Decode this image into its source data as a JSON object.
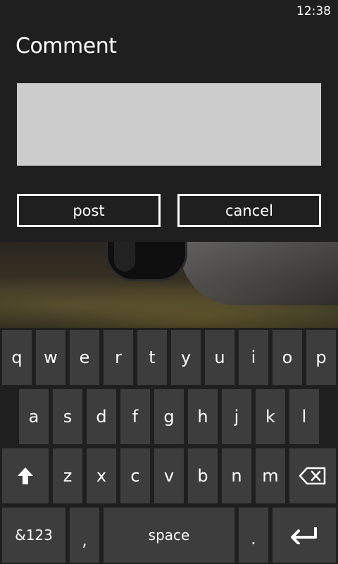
{
  "status_bar": {
    "time": "12:38"
  },
  "dialog": {
    "title": "Comment",
    "comment_value": "",
    "post_label": "post",
    "cancel_label": "cancel"
  },
  "keyboard": {
    "row1": [
      "q",
      "w",
      "e",
      "r",
      "t",
      "y",
      "u",
      "i",
      "o",
      "p"
    ],
    "row2": [
      "a",
      "s",
      "d",
      "f",
      "g",
      "h",
      "j",
      "k",
      "l"
    ],
    "row3": [
      "z",
      "x",
      "c",
      "v",
      "b",
      "n",
      "m"
    ],
    "shift_icon": "shift-arrow-icon",
    "backspace_icon": "backspace-icon",
    "symbols_label": "&123",
    "comma_label": ",",
    "space_label": "space",
    "period_label": ".",
    "enter_icon": "enter-icon"
  },
  "colors": {
    "background": "#1f1f1f",
    "key": "#3d3d3d",
    "text_box": "#cccccc",
    "text": "#ffffff"
  }
}
